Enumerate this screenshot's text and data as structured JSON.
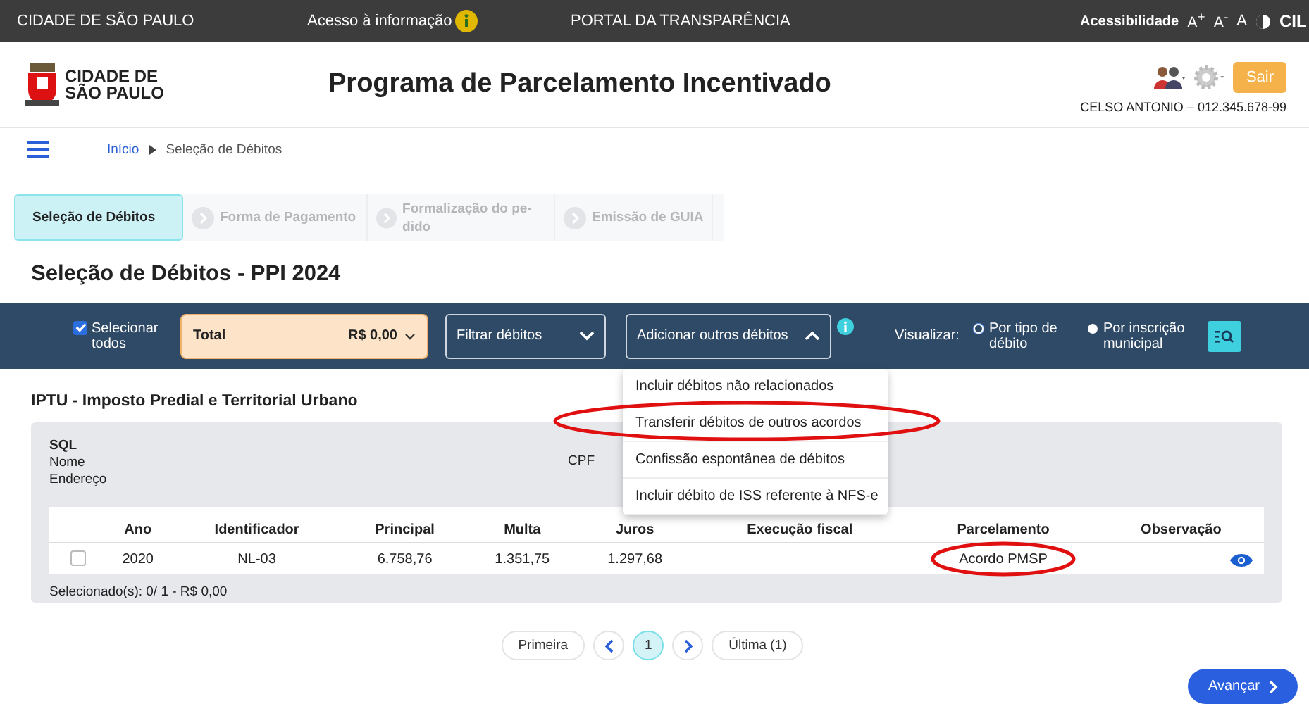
{
  "top_bar": {
    "site": "CIDADE DE SÃO PAULO",
    "info_link": "Acesso à informação",
    "portal": "PORTAL DA TRANSPARÊNCIA",
    "accessibility": "Acessibilidade",
    "font_controls": [
      "A$^{+}$",
      "A$^{-}$",
      "A"
    ],
    "cut_label": "CIL"
  },
  "header": {
    "logo_lines": [
      "CIDADE DE",
      "SÃO PAULO"
    ],
    "title": "Programa de Parcelamento Incentivado",
    "logout": "Sair",
    "user": "CELSO ANTONIO – 012.345.678-99"
  },
  "breadcrumb": [
    "Início",
    "Seleção de Débitos"
  ],
  "steps": [
    {
      "label": "Seleção de Débitos",
      "selected": true
    },
    {
      "label": "Forma de Pagamento",
      "selected": false
    },
    {
      "label": "Formalização do pe-dido",
      "selected": false
    },
    {
      "label": "Emissão de GUIA",
      "selected": false
    }
  ],
  "page_title": "Seleção de Débitos - PPI 2024",
  "toolbar": {
    "select_all": {
      "label": "Selecionar todos",
      "checked": true
    },
    "total": {
      "label": "Total",
      "value": "R$ 0,00"
    },
    "filter": {
      "label": "Filtrar débitos",
      "expanded": false
    },
    "add": {
      "label": "Adicionar outros débitos",
      "expanded": true
    },
    "view_label": "Visualizar:",
    "view_options": [
      {
        "label": "Por tipo de débito",
        "selected": true
      },
      {
        "label": "Por inscrição municipal",
        "selected": false
      }
    ]
  },
  "menu": [
    "Incluir débitos não relacionados",
    "Transferir débitos de outros acordos",
    "Confissão espontânea de débitos",
    "Incluir débito de ISS referente à NFS-e"
  ],
  "section_title": "IPTU - Imposto Predial e Territorial Urbano",
  "record": {
    "fields": [
      "SQL",
      "Nome",
      "Endereço"
    ],
    "cpf_label": "CPF"
  },
  "table": {
    "columns": [
      "Ano",
      "Identificador",
      "Principal",
      "Multa",
      "Juros",
      "Execução fiscal",
      "Parcelamento",
      "Observação"
    ],
    "rows": [
      {
        "checked": false,
        "cells": [
          "2020",
          "NL-03",
          "6.758,76",
          "1.351,75",
          "1.297,68",
          null,
          "Acordo PMSP",
          null
        ]
      }
    ]
  },
  "selection_summary": "Selecionado(s): 0/ 1 - R$ 0,00",
  "pagination": {
    "first": "Primeira",
    "pages": [
      {
        "label": "1",
        "selected": true
      }
    ],
    "last": "Última (1)"
  },
  "next_button": "Avançar"
}
